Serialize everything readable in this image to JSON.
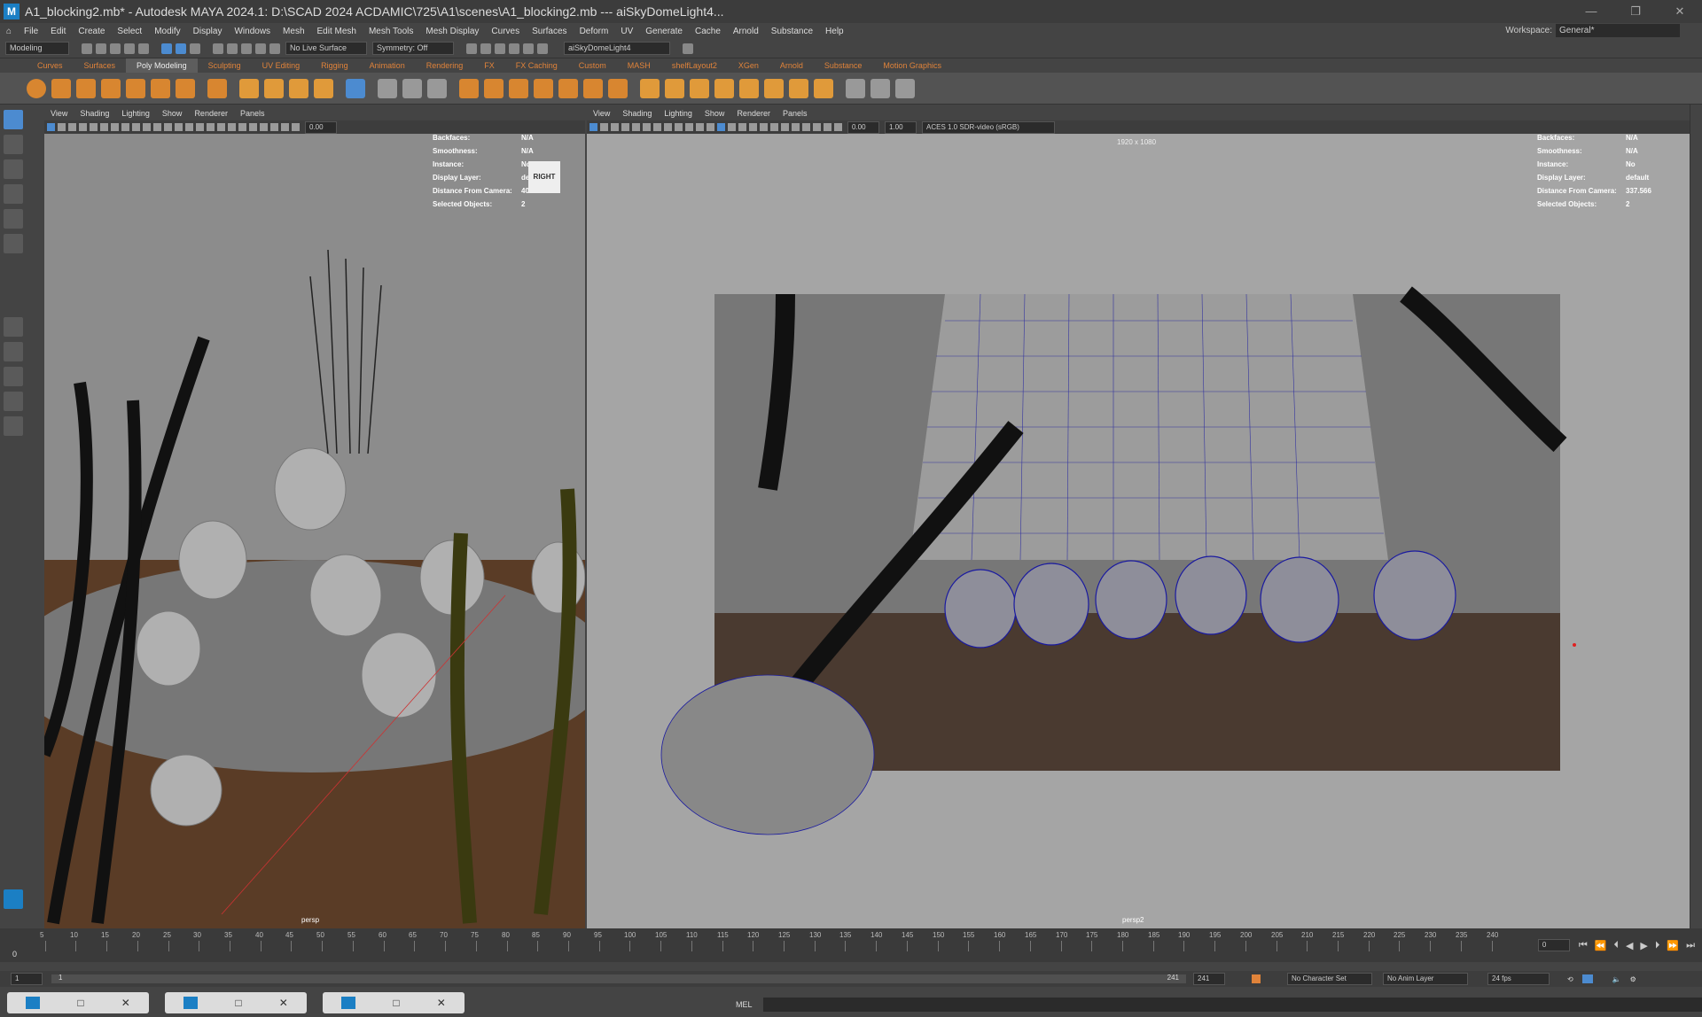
{
  "title": "A1_blocking2.mb* - Autodesk MAYA 2024.1: D:\\SCAD 2024 ACDAMIC\\725\\A1\\scenes\\A1_blocking2.mb   ---   aiSkyDomeLight4...",
  "menu": [
    "File",
    "Edit",
    "Create",
    "Select",
    "Modify",
    "Display",
    "Windows",
    "Mesh",
    "Edit Mesh",
    "Mesh Tools",
    "Mesh Display",
    "Curves",
    "Surfaces",
    "Deform",
    "UV",
    "Generate",
    "Cache",
    "Arnold",
    "Substance",
    "Help"
  ],
  "workspace_label": "Workspace:",
  "workspace_value": "General*",
  "status": {
    "mode": "Modeling",
    "live": "No Live Surface",
    "symmetry": "Symmetry: Off",
    "object": "aiSkyDomeLight4"
  },
  "shelf_tabs": [
    "Curves",
    "Surfaces",
    "Poly Modeling",
    "Sculpting",
    "UV Editing",
    "Rigging",
    "Animation",
    "Rendering",
    "FX",
    "FX Caching",
    "Custom",
    "MASH",
    "shelfLayout2",
    "XGen",
    "Arnold",
    "Substance",
    "Motion Graphics"
  ],
  "viewport_menu": [
    "View",
    "Shading",
    "Lighting",
    "Show",
    "Renderer",
    "Panels"
  ],
  "vp1": {
    "hud": [
      [
        "Backfaces:",
        "N/A"
      ],
      [
        "Smoothness:",
        "N/A"
      ],
      [
        "Instance:",
        "No"
      ],
      [
        "Display Layer:",
        "default"
      ],
      [
        "Distance From Camera:",
        "408.317"
      ],
      [
        "Selected Objects:",
        "2"
      ]
    ],
    "gizmo": "RIGHT",
    "field": "0.00",
    "camera": "persp"
  },
  "vp2": {
    "hud": [
      [
        "Backfaces:",
        "N/A"
      ],
      [
        "Smoothness:",
        "N/A"
      ],
      [
        "Instance:",
        "No"
      ],
      [
        "Display Layer:",
        "default"
      ],
      [
        "Distance From Camera:",
        "337.566"
      ],
      [
        "Selected Objects:",
        "2"
      ]
    ],
    "resolution": "1920 x 1080",
    "field1": "0.00",
    "field2": "1.00",
    "colorspace": "ACES 1.0 SDR-video (sRGB)",
    "camera": "persp2"
  },
  "timeline": {
    "labels": [
      "5",
      "10",
      "15",
      "20",
      "25",
      "30",
      "35",
      "40",
      "45",
      "50",
      "55",
      "60",
      "65",
      "70",
      "75",
      "80",
      "85",
      "90",
      "95",
      "100",
      "105",
      "110",
      "115",
      "120",
      "125",
      "130",
      "135",
      "140",
      "145",
      "150",
      "155",
      "160",
      "165",
      "170",
      "175",
      "180",
      "185",
      "190",
      "195",
      "200",
      "205",
      "210",
      "215",
      "220",
      "225",
      "230",
      "235",
      "240"
    ],
    "start": "0",
    "current": "0"
  },
  "range": {
    "start": "1",
    "start2": "1",
    "end": "241",
    "end2": "241",
    "char_set": "No Character Set",
    "anim_layer": "No Anim Layer",
    "fps": "24 fps"
  },
  "cmd": {
    "label": "MEL"
  },
  "colors": {
    "accent": "#4c8bd0",
    "orange": "#e0833a",
    "wire": "#1a1aa0"
  }
}
